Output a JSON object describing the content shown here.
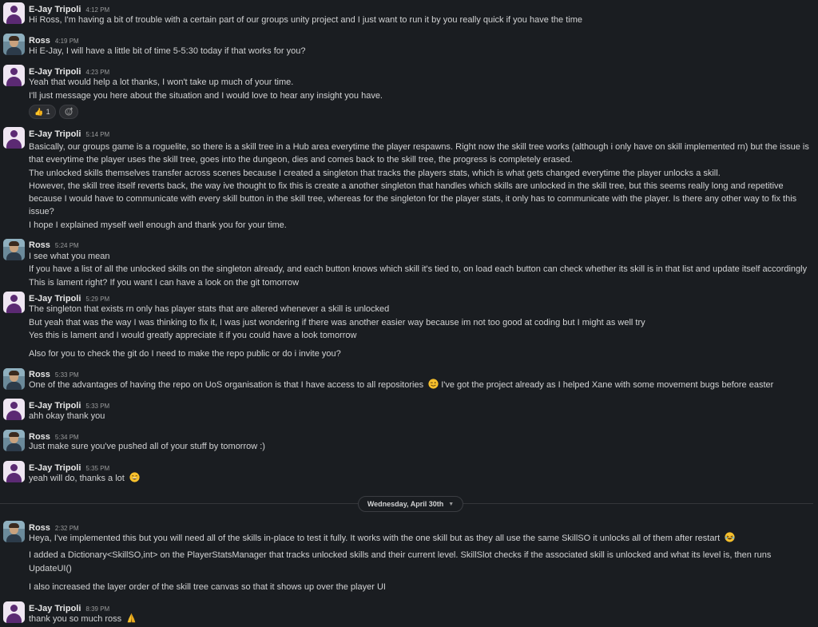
{
  "messages": [
    {
      "author": "E-Jay Tripoli",
      "time": "4:12 PM",
      "lines": [
        "Hi Ross, I'm having a bit of trouble with a certain part of our groups unity project and I just want to run it by you really quick if you have the time"
      ]
    },
    {
      "author": "Ross",
      "time": "4:19 PM",
      "lines": [
        "Hi E-Jay, I will have a little bit of time 5-5:30 today if that works for you?"
      ]
    },
    {
      "author": "E-Jay Tripoli",
      "time": "4:23 PM",
      "lines": [
        "Yeah that would help a lot thanks, I won't take up much of your time.",
        "I'll just message you here about the situation and I would love to hear any insight you have."
      ],
      "reactions": {
        "thumbs_count": "1",
        "thumbs_icon": "thumbs-up-icon",
        "add_icon": "add-reaction-icon"
      }
    },
    {
      "author": "E-Jay Tripoli",
      "time": "5:14 PM",
      "lines": [
        "Basically, our groups game is a roguelite, so there is a skill tree in a Hub area everytime the player respawns. Right now the skill tree works (although i only have on skill implemented rn) but the issue is",
        "that  everytime the player uses the skill tree, goes into the dungeon, dies and comes back to the skill tree, the progress is completely erased.",
        "The unlocked skills themselves transfer across scenes because I created a singleton that tracks the players stats, which is what gets changed everytime the player unlocks a skill.",
        "However, the skill tree itself reverts back, the way ive thought to fix this is create a another singleton that handles which skills are unlocked in the skill tree, but this seems really long and repetitive",
        "because I would have to communicate with every skill button in the skill tree, whereas for the singleton for the player stats, it only has to communicate with the player. Is there any other way to fix this",
        "issue?",
        "I hope I explained myself well enough and thank you for your time."
      ]
    },
    {
      "author": "Ross",
      "time": "5:24 PM",
      "lines": [
        "I see what you mean",
        "If you have a list of all the unlocked skills on the singleton already, and each button knows which skill it's tied to, on load each button can check whether its skill is in that list and update itself accordingly",
        "This is lament right? If you want I can have a look on the git tomorrow"
      ]
    },
    {
      "author": "E-Jay Tripoli",
      "time": "5:29 PM",
      "lines": [
        "The singleton that exists rn only has player stats that are altered whenever a skill is unlocked",
        "But yeah that was the way I was thinking to fix it, I was just wondering if there was another easier way because im not too good at coding but I might as well try",
        "Yes this is lament and I would greatly appreciate it if you could have a look tomorrow",
        "Also for you to check the git do I need to make the repo public or do i invite you?"
      ]
    },
    {
      "author": "Ross",
      "time": "5:33 PM",
      "lines": [
        "One of the advantages of having the repo on UoS organisation is that I have access to all repositories",
        "I've got the project already as I helped Xane with some movement bugs before easter"
      ]
    },
    {
      "author": "E-Jay Tripoli",
      "time": "5:33 PM",
      "lines": [
        "ahh okay thank you"
      ]
    },
    {
      "author": "Ross",
      "time": "5:34 PM",
      "lines": [
        "Just make sure you've pushed all of your stuff by tomorrow :)"
      ]
    },
    {
      "author": "E-Jay Tripoli",
      "time": "5:35 PM",
      "lines": [
        "yeah will do, thanks a lot"
      ]
    },
    {
      "author": "Ross",
      "time": "2:32 PM",
      "lines": [
        "Heya, I've implemented this but you will need all of the skills in-place to test it fully. It works with the one skill but as they all use the same SkillSO it unlocks all of them after restart",
        "I added a Dictionary<SkillSO,int> on the PlayerStatsManager that tracks unlocked skills and their current level. SkillSlot checks if the associated skill is unlocked and what its level is, then runs",
        "UpdateUI()",
        "I also increased the layer order of the skill tree canvas so that it shows up over the player UI"
      ]
    },
    {
      "author": "E-Jay Tripoli",
      "time": "8:39 PM",
      "lines": [
        "thank you so much ross"
      ]
    }
  ],
  "divider": {
    "date": "Wednesday, April 30th",
    "chevron": "chevron-down-icon"
  },
  "colors": {
    "background": "#1a1d21",
    "text": "#d1d2d3",
    "name": "#e8e8e8",
    "timestamp": "#9a9b9c"
  }
}
